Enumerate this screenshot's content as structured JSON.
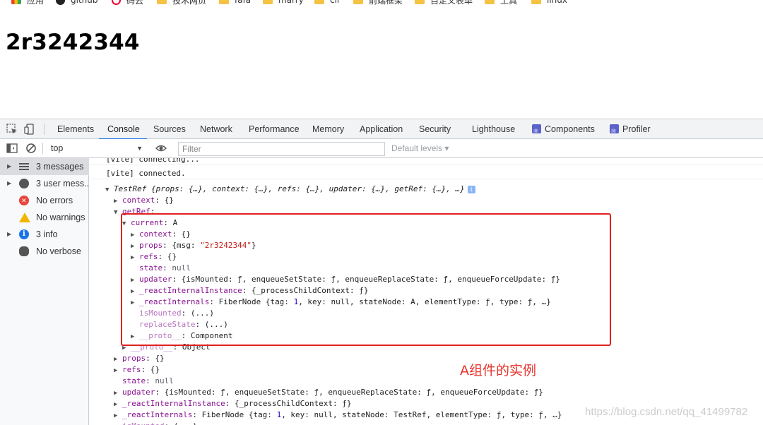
{
  "bookmarks": [
    {
      "label": "应用",
      "icon": "apps-icon"
    },
    {
      "label": "github",
      "icon": "github-icon"
    },
    {
      "label": "码云",
      "icon": "gitee-icon"
    },
    {
      "label": "技术网页",
      "icon": "folder-icon"
    },
    {
      "label": "fafa",
      "icon": "folder-icon"
    },
    {
      "label": "marry",
      "icon": "folder-icon"
    },
    {
      "label": "cli",
      "icon": "folder-icon"
    },
    {
      "label": "前端框架",
      "icon": "folder-icon"
    },
    {
      "label": "自定义表单",
      "icon": "folder-icon"
    },
    {
      "label": "工具",
      "icon": "folder-icon"
    },
    {
      "label": "linux",
      "icon": "folder-icon"
    }
  ],
  "page": {
    "title": "2r3242344"
  },
  "devtools": {
    "tabs": [
      "Elements",
      "Console",
      "Sources",
      "Network",
      "Performance",
      "Memory",
      "Application",
      "Security",
      "Lighthouse",
      "Components",
      "Profiler"
    ],
    "active_tab": "Console",
    "toolbar": {
      "context": "top",
      "filter_placeholder": "Filter",
      "levels": "Default levels ▾"
    },
    "sidebar": [
      {
        "label": "3 messages",
        "icon": "list-icon",
        "expandable": true
      },
      {
        "label": "3 user mess...",
        "icon": "user-icon",
        "expandable": true
      },
      {
        "label": "No errors",
        "icon": "error-icon",
        "expandable": false
      },
      {
        "label": "No warnings",
        "icon": "warning-icon",
        "expandable": false
      },
      {
        "label": "3 info",
        "icon": "info-icon",
        "expandable": true
      },
      {
        "label": "No verbose",
        "icon": "bug-icon",
        "expandable": false
      }
    ],
    "console": {
      "messages": [
        "[vite] connecting...",
        "[vite] connected."
      ],
      "object": {
        "name": "TestRef",
        "preview": "{props: {…}, context: {…}, refs: {…}, updater: {…}, getRef: {…}, …}",
        "context": "{}",
        "getRef_key": "getRef",
        "current_value": "A",
        "inner": {
          "context": "{}",
          "props_prefix": "{msg: ",
          "props_msg": "\"2r3242344\"",
          "props_suffix": "}",
          "refs": "{}",
          "state": "null",
          "updater": "{isMounted: ƒ, enqueueSetState: ƒ, enqueueReplaceState: ƒ, enqueueForceUpdate: ƒ}",
          "reactInternalInstance": "{_processChildContext: ƒ}",
          "reactInternals_a": "FiberNode {tag: ",
          "reactInternals_tag": "1",
          "reactInternals_b": ", key: null, stateNode: A, elementType: ƒ, type: ƒ, …}",
          "isMounted": "(...)",
          "replaceState": "(...)",
          "proto": "Component"
        },
        "getRef_proto": "Object",
        "props": "{}",
        "refs": "{}",
        "state": "null",
        "updater": "{isMounted: ƒ, enqueueSetState: ƒ, enqueueReplaceState: ƒ, enqueueForceUpdate: ƒ}",
        "reactInternalInstance": "{_processChildContext: ƒ}",
        "reactInternals_a": "FiberNode {tag: ",
        "reactInternals_tag": "1",
        "reactInternals_b": ", key: null, stateNode: TestRef, elementType: ƒ, type: ƒ, …}",
        "isMounted": "(...)"
      }
    }
  },
  "annotation": "A组件的实例",
  "watermark": "https://blog.csdn.net/qq_41499782",
  "colors": {
    "highlight_box": "#e02020",
    "annotation": "#e8332b",
    "active_tab_underline": "#1a73e8"
  }
}
